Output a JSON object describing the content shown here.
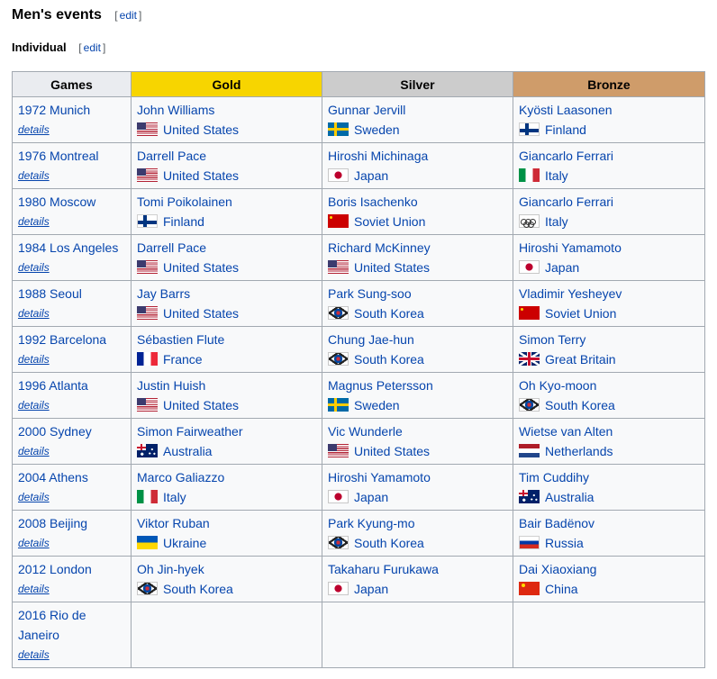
{
  "section": {
    "title": "Men's events",
    "edit_label": "edit"
  },
  "subsection": {
    "title": "Individual",
    "edit_label": "edit"
  },
  "table": {
    "headers": {
      "games": "Games",
      "gold": "Gold",
      "silver": "Silver",
      "bronze": "Bronze"
    },
    "colors": {
      "gold": "#f7d500",
      "silver": "#cccccc",
      "bronze": "#cf9c6a",
      "link": "#0645ad"
    },
    "details_label": "details",
    "rows": [
      {
        "games": "1972 Munich",
        "gold": {
          "name": "John Williams",
          "country": "United States",
          "flag": "us-flag-icon"
        },
        "silver": {
          "name": "Gunnar Jervill",
          "country": "Sweden",
          "flag": "sweden-flag-icon"
        },
        "bronze": {
          "name": "Kyösti Laasonen",
          "country": "Finland",
          "flag": "finland-flag-icon"
        }
      },
      {
        "games": "1976 Montreal",
        "gold": {
          "name": "Darrell Pace",
          "country": "United States",
          "flag": "us-flag-icon"
        },
        "silver": {
          "name": "Hiroshi Michinaga",
          "country": "Japan",
          "flag": "japan-flag-icon"
        },
        "bronze": {
          "name": "Giancarlo Ferrari",
          "country": "Italy",
          "flag": "italy-flag-icon"
        }
      },
      {
        "games": "1980 Moscow",
        "gold": {
          "name": "Tomi Poikolainen",
          "country": "Finland",
          "flag": "finland-flag-icon"
        },
        "silver": {
          "name": "Boris Isachenko",
          "country": "Soviet Union",
          "flag": "soviet-union-flag-icon"
        },
        "bronze": {
          "name": "Giancarlo Ferrari",
          "country": "Italy",
          "flag": "olympic-flag-icon"
        }
      },
      {
        "games": "1984 Los Angeles",
        "gold": {
          "name": "Darrell Pace",
          "country": "United States",
          "flag": "us-flag-icon"
        },
        "silver": {
          "name": "Richard McKinney",
          "country": "United States",
          "flag": "us-flag-icon"
        },
        "bronze": {
          "name": "Hiroshi Yamamoto",
          "country": "Japan",
          "flag": "japan-flag-icon"
        }
      },
      {
        "games": "1988 Seoul",
        "gold": {
          "name": "Jay Barrs",
          "country": "United States",
          "flag": "us-flag-icon"
        },
        "silver": {
          "name": "Park Sung-soo",
          "country": "South Korea",
          "flag": "south-korea-flag-icon"
        },
        "bronze": {
          "name": "Vladimir Yesheyev",
          "country": "Soviet Union",
          "flag": "soviet-union-flag-icon"
        }
      },
      {
        "games": "1992 Barcelona",
        "gold": {
          "name": "Sébastien Flute",
          "country": "France",
          "flag": "france-flag-icon"
        },
        "silver": {
          "name": "Chung Jae-hun",
          "country": "South Korea",
          "flag": "south-korea-flag-icon"
        },
        "bronze": {
          "name": "Simon Terry",
          "country": "Great Britain",
          "flag": "great-britain-flag-icon"
        }
      },
      {
        "games": "1996 Atlanta",
        "gold": {
          "name": "Justin Huish",
          "country": "United States",
          "flag": "us-flag-icon"
        },
        "silver": {
          "name": "Magnus Petersson",
          "country": "Sweden",
          "flag": "sweden-flag-icon"
        },
        "bronze": {
          "name": "Oh Kyo-moon",
          "country": "South Korea",
          "flag": "south-korea-flag-icon"
        }
      },
      {
        "games": "2000 Sydney",
        "gold": {
          "name": "Simon Fairweather",
          "country": "Australia",
          "flag": "australia-flag-icon"
        },
        "silver": {
          "name": "Vic Wunderle",
          "country": "United States",
          "flag": "us-flag-icon"
        },
        "bronze": {
          "name": "Wietse van Alten",
          "country": "Netherlands",
          "flag": "netherlands-flag-icon"
        }
      },
      {
        "games": "2004 Athens",
        "gold": {
          "name": "Marco Galiazzo",
          "country": "Italy",
          "flag": "italy-flag-icon"
        },
        "silver": {
          "name": "Hiroshi Yamamoto",
          "country": "Japan",
          "flag": "japan-flag-icon"
        },
        "bronze": {
          "name": "Tim Cuddihy",
          "country": "Australia",
          "flag": "australia-flag-icon"
        }
      },
      {
        "games": "2008 Beijing",
        "gold": {
          "name": "Viktor Ruban",
          "country": "Ukraine",
          "flag": "ukraine-flag-icon"
        },
        "silver": {
          "name": "Park Kyung-mo",
          "country": "South Korea",
          "flag": "south-korea-flag-icon"
        },
        "bronze": {
          "name": "Bair Badënov",
          "country": "Russia",
          "flag": "russia-flag-icon"
        }
      },
      {
        "games": "2012 London",
        "gold": {
          "name": "Oh Jin-hyek",
          "country": "South Korea",
          "flag": "south-korea-flag-icon"
        },
        "silver": {
          "name": "Takaharu Furukawa",
          "country": "Japan",
          "flag": "japan-flag-icon"
        },
        "bronze": {
          "name": "Dai Xiaoxiang",
          "country": "China",
          "flag": "china-flag-icon"
        }
      },
      {
        "games": "2016 Rio de Janeiro",
        "gold": null,
        "silver": null,
        "bronze": null
      }
    ]
  }
}
